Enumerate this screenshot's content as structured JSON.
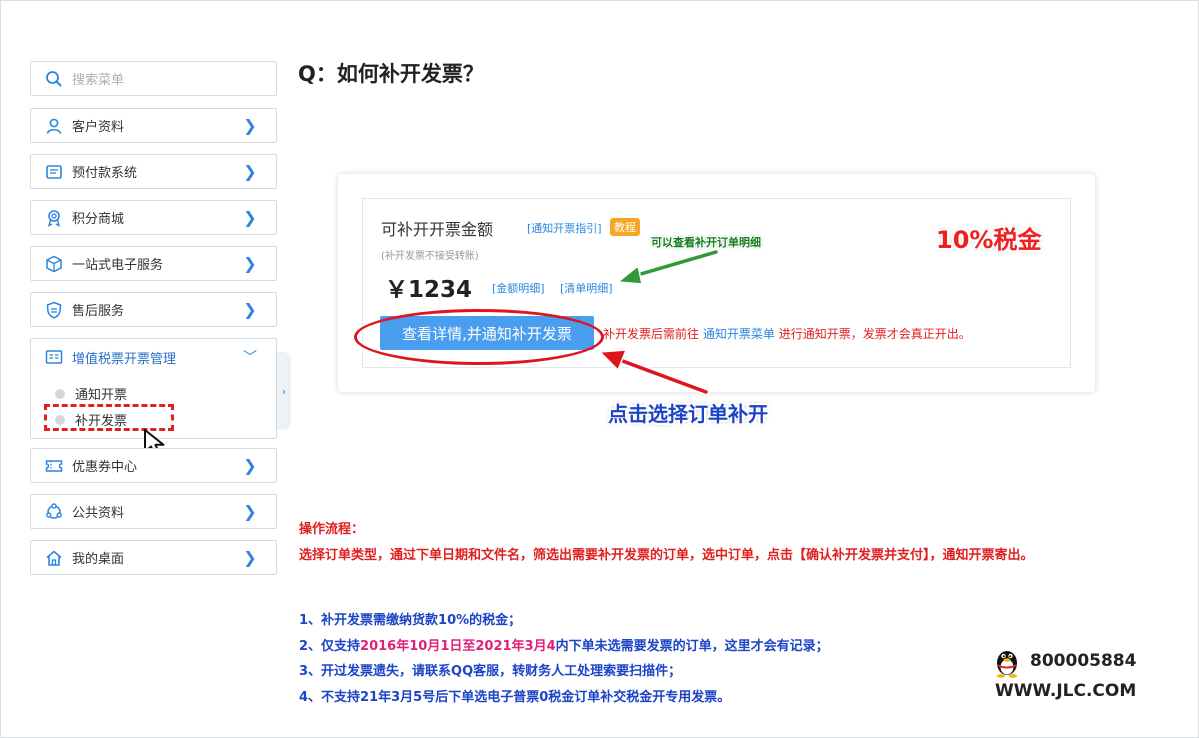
{
  "sidebar": {
    "search_placeholder": "搜索菜单",
    "items": [
      {
        "label": "客户资料",
        "icon": "user-icon"
      },
      {
        "label": "预付款系统",
        "icon": "prepay-icon"
      },
      {
        "label": "积分商城",
        "icon": "medal-icon"
      },
      {
        "label": "一站式电子服务",
        "icon": "cube-icon"
      },
      {
        "label": "售后服务",
        "icon": "shield-icon"
      },
      {
        "label": "增值税票开票管理",
        "icon": "invoice-icon"
      },
      {
        "label": "优惠券中心",
        "icon": "coupon-icon"
      },
      {
        "label": "公共资料",
        "icon": "share-icon"
      },
      {
        "label": "我的桌面",
        "icon": "home-icon"
      }
    ],
    "sub_items": [
      "通知开票",
      "补开发票"
    ],
    "chevron": "❯",
    "chevron_down": "﹀",
    "collapse_arrow": "›"
  },
  "main": {
    "title": "Q：如何补开发票？",
    "card": {
      "amount_title": "可补开开票金额",
      "guide_link": "[通知开票指引]",
      "tutorial_badge": "教程",
      "note": "(补开发票不接受转账)",
      "amount": "￥1234",
      "amount_detail_link": "[金额明细]",
      "list_detail_link": "[清单明细]",
      "button_label": "查看详情,并通知补开发票",
      "hint_before": "补开发票后需前往",
      "hint_link": "通知开票菜单",
      "hint_after": "进行通知开票，发票才会真正开出。"
    },
    "annotations": {
      "tax": "10%税金",
      "green_note": "可以查看补开订单明细",
      "click_note": "点击选择订单补开"
    },
    "process": {
      "title": "操作流程：",
      "desc": "选择订单类型，通过下单日期和文件名，筛选出需要补开发票的订单，选中订单，点击【确认补开发票并支付】，通知开票寄出。"
    },
    "rules": {
      "r1": "1、补开发票需缴纳货款10%的税金；",
      "r2_before": "2、仅支持",
      "r2_highlight": "2016年10月1日至2021年3月4",
      "r2_after": "内下单未选需要发票的订单，这里才会有记录；",
      "r3": "3、开过发票遗失，请联系QQ客服，转财务人工处理索要扫描件；",
      "r4": "4、不支持21年3月5号后下单选电子普票0税金订单补交税金开专用发票。"
    },
    "contact": {
      "qq": "800005884",
      "site": "WWW.JLC.COM"
    }
  },
  "colors": {
    "accent_blue": "#2a86e0",
    "button_blue": "#4a9ef0",
    "alert_red": "#e02020",
    "rule_blue": "#1c44c7",
    "highlight_pink": "#e0207a",
    "badge_orange": "#f5a623",
    "note_green": "#0f7d1a"
  }
}
